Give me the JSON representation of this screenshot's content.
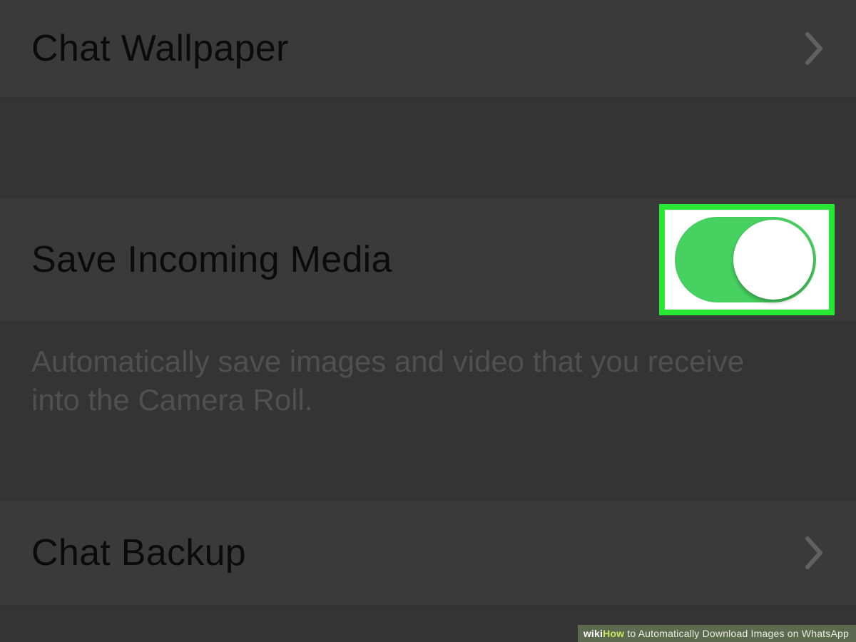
{
  "settings": {
    "chat_wallpaper": {
      "label": "Chat Wallpaper"
    },
    "save_incoming_media": {
      "label": "Save Incoming Media",
      "description": "Automatically save images and video that you receive into the Camera Roll.",
      "value_on": true
    },
    "chat_backup": {
      "label": "Chat Backup"
    }
  },
  "footer": {
    "wiki": "wiki",
    "how": "How",
    "title": " to Automatically Download Images on WhatsApp"
  },
  "colors": {
    "highlight_border": "#27e833",
    "switch_on": "#46d160"
  }
}
